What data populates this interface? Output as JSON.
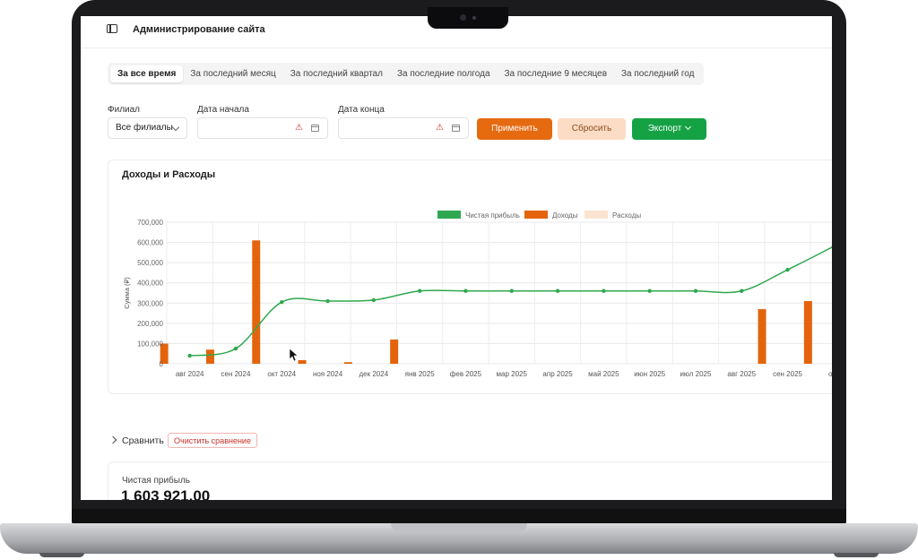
{
  "header": {
    "title": "Администрирование сайта"
  },
  "tabs": [
    {
      "label": "За все время",
      "active": true
    },
    {
      "label": "За последний месяц",
      "active": false
    },
    {
      "label": "За последний квартал",
      "active": false
    },
    {
      "label": "За последние полгода",
      "active": false
    },
    {
      "label": "За последние 9 месяцев",
      "active": false
    },
    {
      "label": "За последний год",
      "active": false
    }
  ],
  "filters": {
    "branch_label": "Филиал",
    "branch_value": "Все филиалы",
    "start_label": "Дата начала",
    "start_value": "",
    "end_label": "Дата конца",
    "end_value": ""
  },
  "buttons": {
    "apply": "Применить",
    "reset": "Сбросить",
    "export": "Экспорт"
  },
  "chart_card": {
    "title": "Доходы и Расходы"
  },
  "chart_data": {
    "type": "bar",
    "title": "",
    "ylabel": "Сумма (₽)",
    "xlabel": "",
    "categories": [
      "авг 2024",
      "сен 2024",
      "окт 2024",
      "ноя 2024",
      "дек 2024",
      "янв 2025",
      "фев 2025",
      "мар 2025",
      "апр 2025",
      "май 2025",
      "июн 2025",
      "июл 2025",
      "авг 2025",
      "сен 2025",
      "окт"
    ],
    "yticks": [
      "700,000",
      "600,000",
      "500,000",
      "400,000",
      "300,000",
      "200,000",
      "100,000",
      "0"
    ],
    "ylim": [
      0,
      700000
    ],
    "legend_position": "top",
    "grid": true,
    "series": [
      {
        "name": "Чистая прибыль",
        "kind": "line",
        "color": "#2fa84f",
        "values": [
          40000,
          75000,
          305000,
          310000,
          315000,
          360000,
          360000,
          360000,
          360000,
          360000,
          360000,
          360000,
          360000,
          465000,
          580000
        ]
      },
      {
        "name": "Доходы",
        "kind": "bar",
        "color": "#e3640d",
        "values": [
          100000,
          70000,
          610000,
          18000,
          8000,
          120000,
          0,
          0,
          0,
          0,
          0,
          0,
          0,
          270000,
          310000
        ]
      },
      {
        "name": "Расходы",
        "kind": "bar",
        "color": "#fbe3cf",
        "values": [
          0,
          0,
          0,
          0,
          0,
          0,
          0,
          0,
          0,
          0,
          0,
          0,
          0,
          0,
          0
        ]
      }
    ]
  },
  "compare": {
    "label": "Сравнить",
    "clear": "Очистить сравнение"
  },
  "summary": {
    "label": "Чистая прибыль",
    "value": "1 603 921,00"
  },
  "icons": {
    "sidebar": "sidebar-toggle-icon",
    "calendar": "calendar-icon",
    "warning": "warning-icon",
    "cursor": "cursor-icon"
  }
}
